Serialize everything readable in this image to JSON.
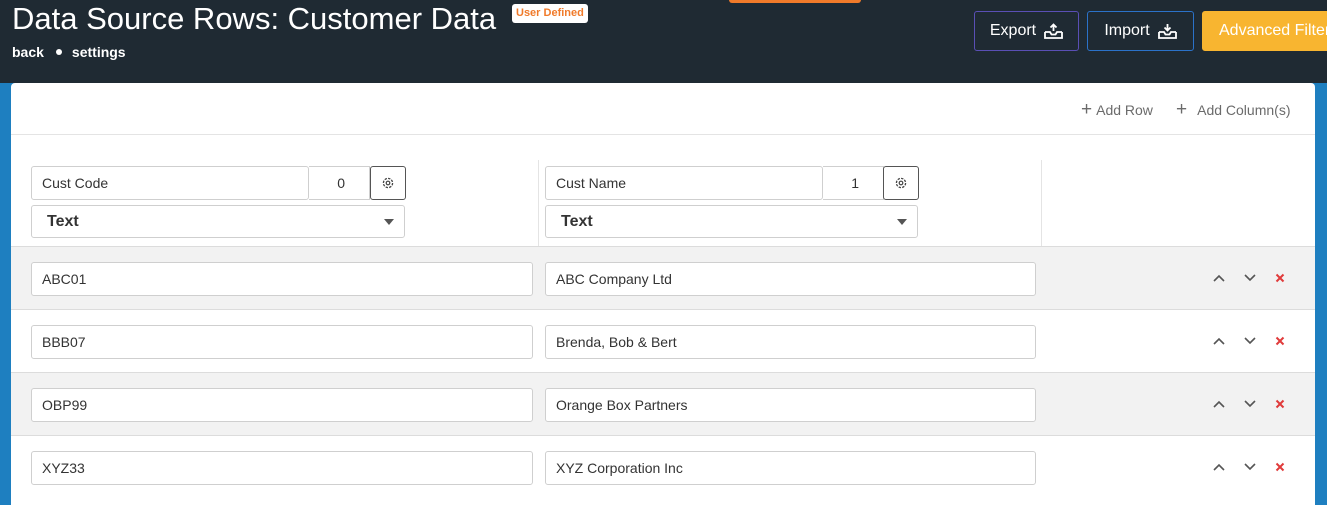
{
  "header": {
    "title": "Data Source Rows: Customer Data",
    "badge": "User Defined",
    "breadcrumbs": [
      "back",
      "settings"
    ],
    "buttons": {
      "export": "Export",
      "import": "Import",
      "advanced_filter": "Advanced Filter"
    }
  },
  "toolbar": {
    "add_row": "Add Row",
    "add_columns": "Add Column(s)"
  },
  "columns": [
    {
      "name": "Cust Code",
      "index": "0",
      "type": "Text"
    },
    {
      "name": "Cust Name",
      "index": "1",
      "type": "Text"
    }
  ],
  "rows": [
    {
      "code": "ABC01",
      "name": "ABC Company Ltd"
    },
    {
      "code": "BBB07",
      "name": "Brenda, Bob & Bert"
    },
    {
      "code": "OBP99",
      "name": "Orange Box Partners"
    },
    {
      "code": "XYZ33",
      "name": "XYZ Corporation Inc"
    }
  ],
  "icons": {
    "export": "tray-upload-icon",
    "import": "tray-download-icon",
    "settings": "gear-icon",
    "move_up": "chevron-up-icon",
    "move_down": "chevron-down-icon",
    "delete": "close-icon"
  },
  "colors": {
    "topbar": "#1f2a33",
    "accent_orange": "#f07a2a",
    "advanced_filter": "#f8b530",
    "side_blue": "#1e7fc0",
    "delete_red": "#e03b3b"
  }
}
